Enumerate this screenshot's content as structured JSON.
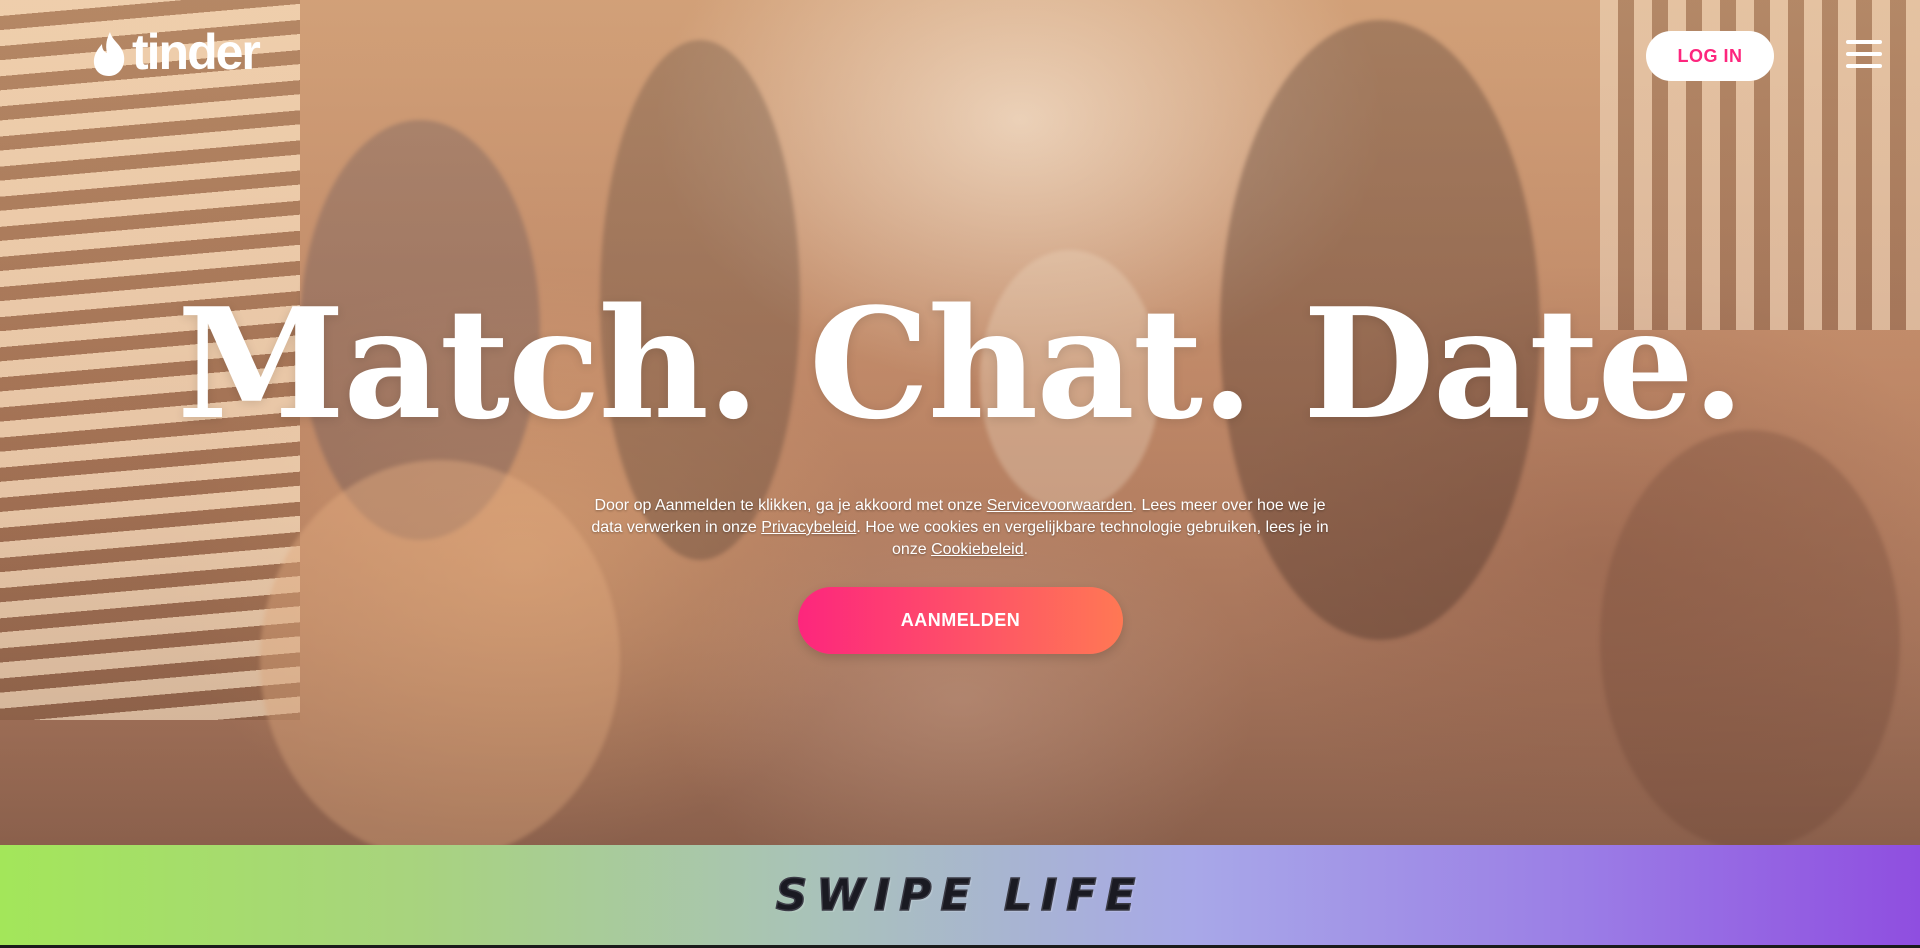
{
  "header": {
    "logo_text": "tinder",
    "login_label": "LOG IN"
  },
  "hero": {
    "headline": "Match. Chat. Date.",
    "legal": {
      "part1": "Door op Aanmelden te klikken, ga je akkoord met onze ",
      "terms_link": "Servicevoorwaarden",
      "part2": ". Lees meer over hoe we je data verwerken in onze ",
      "privacy_link": "Privacybeleid",
      "part3": ". Hoe we cookies en vergelijkbare technologie gebruiken, lees je in onze ",
      "cookie_link": "Cookiebeleid",
      "part4": "."
    },
    "signup_label": "AANMELDEN"
  },
  "banner": {
    "text": "SWIPE LIFE"
  },
  "colors": {
    "brand_pink": "#fd267d",
    "brand_orange": "#ff7854",
    "banner_green": "#a3e65a",
    "banner_purple": "#8f4ee0"
  },
  "icons": {
    "logo": "flame-icon",
    "menu": "hamburger-menu-icon"
  }
}
